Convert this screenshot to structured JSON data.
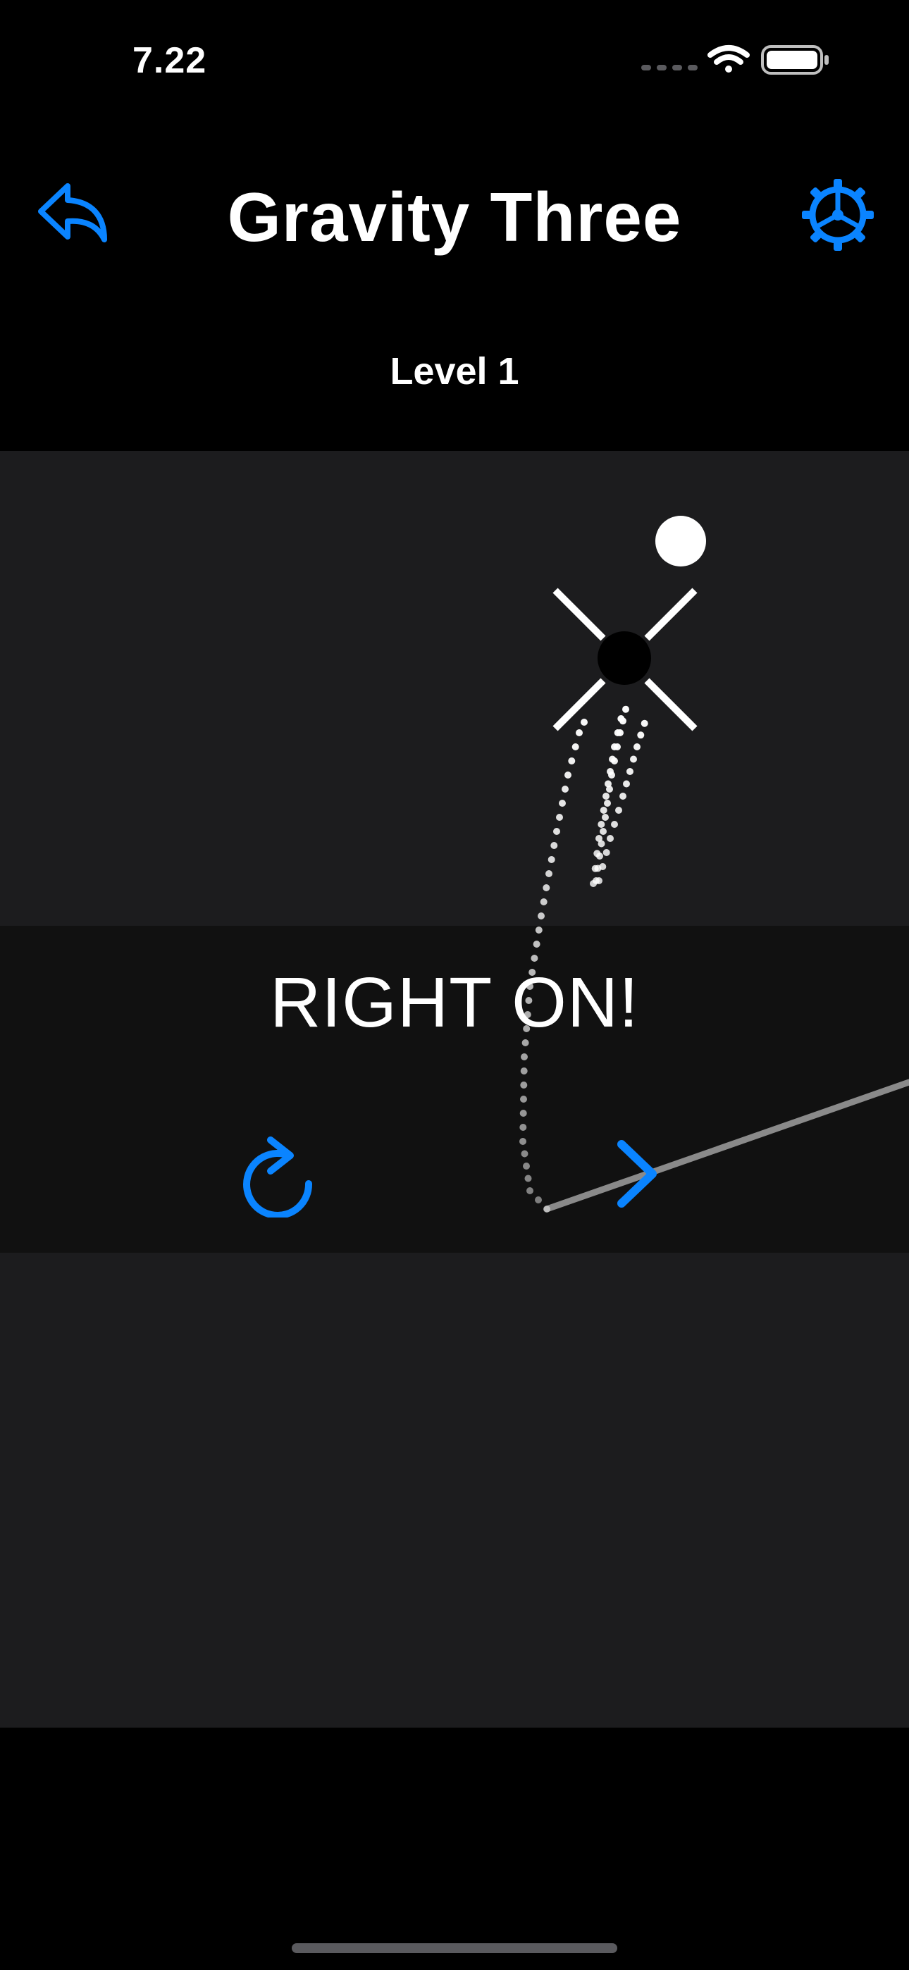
{
  "status_bar": {
    "time": "7.22",
    "icons": [
      "cellular-signal-icon",
      "wifi-icon",
      "battery-icon"
    ]
  },
  "nav": {
    "title": "Gravity Three",
    "back_icon": "reply-arrow-icon",
    "settings_icon": "gear-icon"
  },
  "level": {
    "label": "Level 1"
  },
  "result": {
    "message": "RIGHT ON!",
    "retry_icon": "restart-icon",
    "next_icon": "chevron-right-icon"
  },
  "colors": {
    "accent": "#0a84ff",
    "background": "#000000",
    "game_area": "#1c1c1e",
    "result_panel": "#111111",
    "text": "#ffffff"
  }
}
